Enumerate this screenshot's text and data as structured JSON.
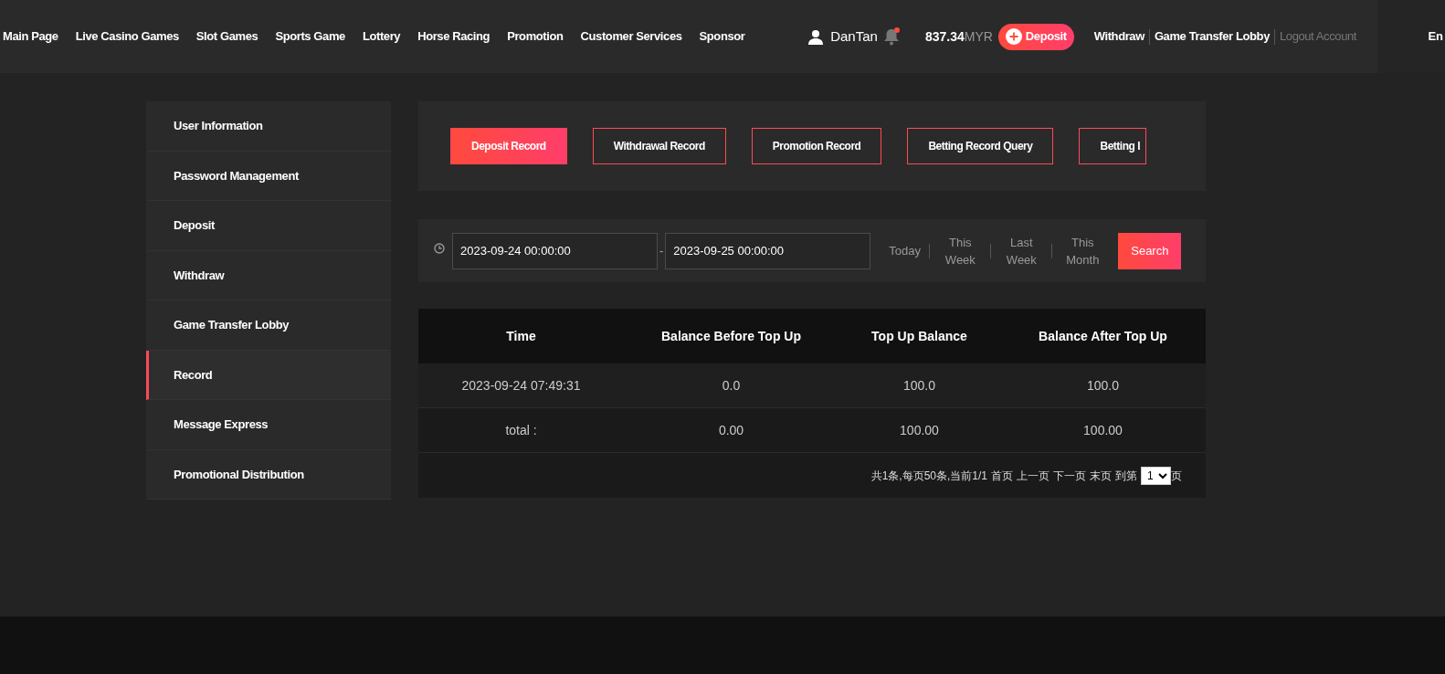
{
  "nav": {
    "items": [
      "Main Page",
      "Live Casino Games",
      "Slot Games",
      "Sports Game",
      "Lottery",
      "Horse Racing",
      "Promotion",
      "Customer Services",
      "Sponsor"
    ]
  },
  "account": {
    "username": "DanTan",
    "has_notification": true,
    "balance": "837.34",
    "currency": "MYR",
    "deposit_button": "Deposit",
    "links": [
      {
        "label": "Withdraw",
        "kind": "link"
      },
      {
        "label": "Game Transfer Lobby",
        "kind": "link"
      },
      {
        "label": "Logout Account",
        "kind": "muted"
      }
    ],
    "language": "En"
  },
  "sidebar": {
    "items": [
      {
        "label": "User Information",
        "selected": false
      },
      {
        "label": "Password Management",
        "selected": false
      },
      {
        "label": "Deposit",
        "selected": false
      },
      {
        "label": "Withdraw",
        "selected": false
      },
      {
        "label": "Game Transfer Lobby",
        "selected": false
      },
      {
        "label": "Record",
        "selected": true
      },
      {
        "label": "Message Express",
        "selected": false
      },
      {
        "label": "Promotional Distribution",
        "selected": false
      }
    ]
  },
  "record_tabs": [
    {
      "label": "Deposit Record",
      "selected": true
    },
    {
      "label": "Withdrawal Record",
      "selected": false
    },
    {
      "label": "Promotion Record",
      "selected": false
    },
    {
      "label": "Betting Record Query",
      "selected": false
    },
    {
      "label": "Betting I",
      "selected": false
    }
  ],
  "filter": {
    "start": "2023-09-24 00:00:00",
    "separator": "-",
    "end": "2023-09-25 00:00:00",
    "ranges": [
      "Today",
      "This Week",
      "Last Week",
      "This Month"
    ],
    "search_button": "Search"
  },
  "table": {
    "columns": [
      "Time",
      "Balance Before Top Up",
      "Top Up Balance",
      "Balance After Top Up"
    ],
    "rows": [
      [
        "2023-09-24 07:49:31",
        "0.0",
        "100.0",
        "100.0"
      ],
      [
        "total :",
        "0.00",
        "100.00",
        "100.00"
      ]
    ]
  },
  "pagination": {
    "summary": "共1条,每页50条,当前1/1",
    "links": [
      "首页",
      "上一页",
      "下一页",
      "末页"
    ],
    "goto_prefix": "到第",
    "page": "1",
    "goto_suffix": "页"
  }
}
